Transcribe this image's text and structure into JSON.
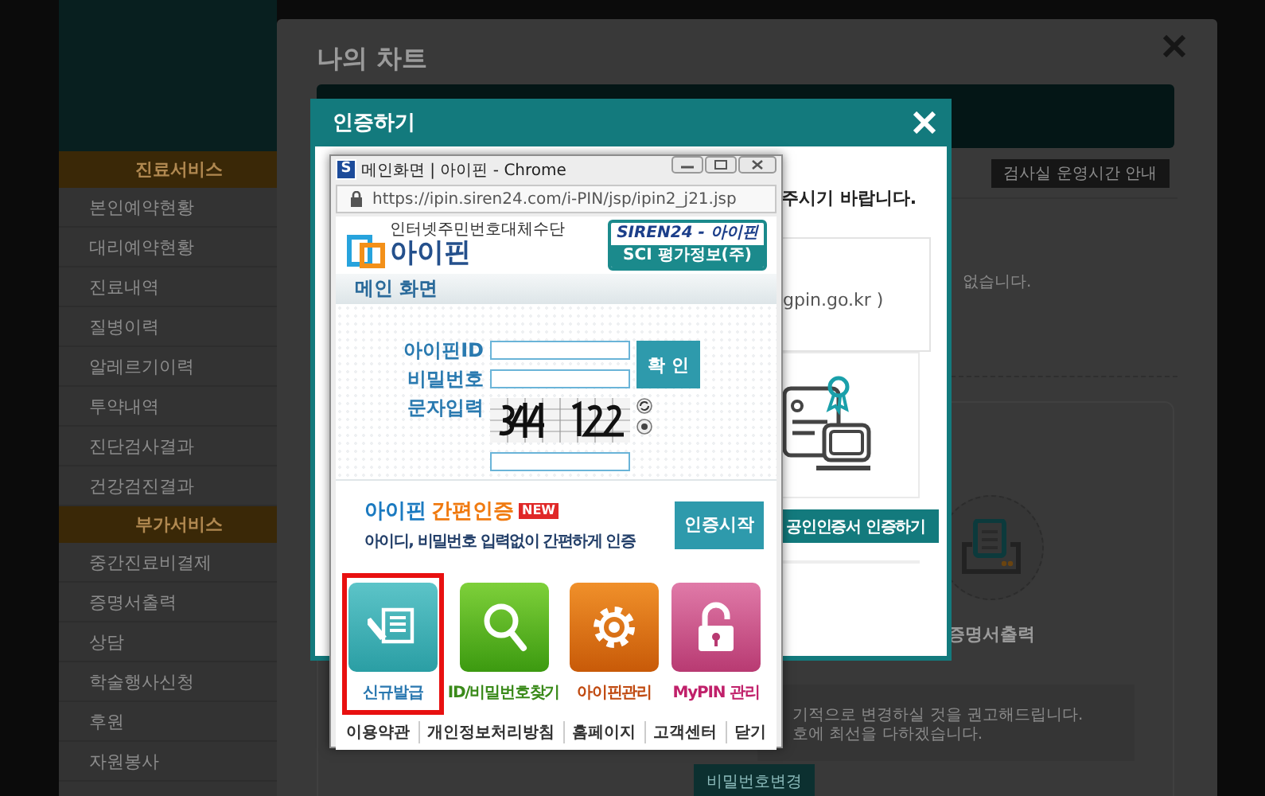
{
  "sidebar": {
    "sections": [
      {
        "title": "진료서비스",
        "items": [
          "본인예약현황",
          "대리예약현황",
          "진료내역",
          "질병이력",
          "알레르기이력",
          "투약내역",
          "진단검사결과",
          "건강검진결과"
        ]
      },
      {
        "title": "부가서비스",
        "items": [
          "중간진료비결제",
          "증명서출력",
          "상담",
          "학술행사신청",
          "후원",
          "자원봉사"
        ]
      }
    ]
  },
  "chart_modal": {
    "title": "나의 차트",
    "schedule_button": "검사실 운영시간 안내",
    "notice_fragment": "없습니다.",
    "print_label": "증명서출력",
    "notice_lines": [
      "기적으로 변경하실 것을 권고해드립니다.",
      "호에 최선을 다하겠습니다."
    ],
    "password_button": "비밀번호변경"
  },
  "auth_modal": {
    "title": "인증하기",
    "instruction": "주시기 바랍니다.",
    "gpin_text": "gpin.go.kr )",
    "cert_button": "공인인증서 인증하기"
  },
  "browser_window": {
    "app_icon": "S",
    "title": "메인화면 | 아이핀 - Chrome",
    "url": "https://ipin.siren24.com/i-PIN/jsp/ipin2_j21.jsp",
    "logo_tagline": "인터넷주민번호대체수단",
    "logo_text": "아이핀",
    "badge_lines": [
      "SIREN24 - 아이핀",
      "SCI 평가정보(주)"
    ],
    "section_title": "메인 화면",
    "fields": [
      {
        "label": "아이핀ID"
      },
      {
        "label": "비밀번호"
      },
      {
        "label": "문자입력"
      }
    ],
    "confirm_button": "확 인",
    "easy_auth": {
      "brand": "아이핀",
      "title": "간편인증",
      "badge": "NEW",
      "subtitle": "아이디, 비밀번호 입력없이 간편하게 인증",
      "button": "인증시작"
    },
    "tiles": [
      {
        "label": "신규발급",
        "kind": "issue",
        "highlighted": true
      },
      {
        "label": "ID/비밀번호찾기",
        "kind": "find",
        "highlighted": false
      },
      {
        "label": "아이핀관리",
        "kind": "manage",
        "highlighted": false
      },
      {
        "label": "MyPIN 관리",
        "kind": "mypin",
        "highlighted": false
      }
    ],
    "footer_links": [
      "이용약관",
      "개인정보처리방침",
      "홈페이지",
      "고객센터",
      "닫기"
    ]
  }
}
